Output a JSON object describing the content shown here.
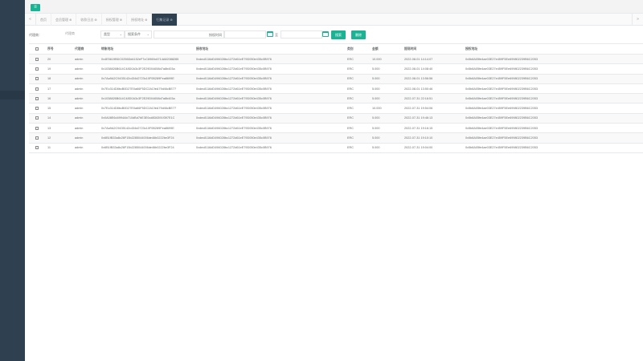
{
  "menu_button": "≡",
  "tab_prev": "«",
  "tab_next": "»",
  "tabs": [
    {
      "label": "首页",
      "closable": false
    },
    {
      "label": "会员管理",
      "closable": true
    },
    {
      "label": "收款日志",
      "closable": true
    },
    {
      "label": "授权管理",
      "closable": true
    },
    {
      "label": "授权地址",
      "closable": true
    },
    {
      "label": "归集记录",
      "closable": true,
      "active": true
    }
  ],
  "filters": {
    "agent_label": "代理商：",
    "agent_placeholder": "代理商",
    "type_select": "类型",
    "field_select": "搜索条件",
    "time_label": "授权时间",
    "to_label": "至",
    "search_button": "搜索",
    "delete_button": "删除"
  },
  "table": {
    "headers": [
      "",
      "序号",
      "代理商",
      "转账地址",
      "接收地址",
      "类别",
      "金额",
      "提现时间",
      "授权地址"
    ],
    "rows": [
      [
        "20",
        "admin",
        "0x4E5619BDC0256Dd4152eF7cC6969c6714A82088285",
        "0xdec8116dD496028bc1272d61eE79D050e435c0B976",
        "ERC",
        "10.000",
        "2022-08-01 14:14:07",
        "0x5b8A05fe4ae03E27e459F5Ee699802239B6C2053"
      ],
      [
        "19",
        "admin",
        "0x1038826B614C48D0A3c3F2E29D04658d7a8b403a",
        "0xdec8116dD496028bc1272d61eE79D050e435c0B976",
        "ERC",
        "5.000",
        "2022-08-01 14:08:40",
        "0x5b8A05fe4ae03E27e459F5Ee699802239B6C2053"
      ],
      [
        "18",
        "admin",
        "0x7Aa9A2C9435142c434d2723c10F0B289Fea8699E",
        "0xdec8116dD496028bc1272d61eE79D050e435c0B976",
        "ERC",
        "5.000",
        "2022-08-01 13:56:56",
        "0x5b8A05fe4ae03E27e459F5Ee699802239B6C2053"
      ],
      [
        "17",
        "admin",
        "0x7Ec314D8bcB0D27E0a66F5DC2ACfeA79d46cBE77",
        "0xdec8116dD496028bc1272d61eE79D050e435c0B976",
        "ERC",
        "5.000",
        "2022-08-01 13:50:46",
        "0x5b8A05fe4ae03E27e459F5Ee699802239B6C2053"
      ],
      [
        "16",
        "admin",
        "0x1038826B614C48D0A3c3F2E29D04658d7a8b403a",
        "0xdec8116dD496028bc1272d61eE79D050e435c0B976",
        "ERC",
        "5.000",
        "2022-07-31 22:16:51",
        "0x5b8A05fe4ae03E27e459F5Ee699802239B6C2053"
      ],
      [
        "15",
        "admin",
        "0x7Ec314D8bcB0D27E0a66F5DC2ACfeA79d46cBE77",
        "0xdec8116dD496028bc1272d61eE79D050e435c0B976",
        "ERC",
        "10.000",
        "2022-07-31 19:54:06",
        "0x5b8A05fe4ae03E27e459F5Ee699802239B6C2053"
      ],
      [
        "14",
        "admin",
        "0x0A08E6d4994Ab710dBd7bE3E0cd8D6391f397E1C",
        "0xdec8116dD496028bc1272d61eE79D050e435c0B976",
        "ERC",
        "5.000",
        "2022-07-31 19:46:13",
        "0x5b8A05fe4ae03E27e459F5Ee699802239B6C2053"
      ],
      [
        "13",
        "admin",
        "0x7Aa9A2C9435142c434d2723c10F0B289Fea8699E",
        "0xdec8116dD496028bc1272d61eE79D050e435c0B976",
        "ERC",
        "5.000",
        "2022-07-31 19:16:15",
        "0x5b8A05fe4ae03E27e459F5Ee699802239B6C2053"
      ],
      [
        "12",
        "admin",
        "0x6B1fB33a8c26F15b2285044006de46b0222be3F24",
        "0xdec8116dD496028bc1272d61eE79D050e435c0B976",
        "ERC",
        "5.000",
        "2022-07-31 19:10:10",
        "0x5b8A05fe4ae03E27e459F5Ee699802239B6C2053"
      ],
      [
        "11",
        "admin",
        "0x6B1fB33a8c26F15b2285044006de46b0222be3F24",
        "0xdec8116dD496028bc1272d61eE79D050e435c0B976",
        "ERC",
        "5.000",
        "2022-07-31 19:04:00",
        "0x5b8A05fe4ae03E27e459F5Ee699802239B6C2053"
      ]
    ]
  },
  "colors": {
    "accent": "#1ab394",
    "sidebar": "#2f4050",
    "active_tab": "#2f4050"
  }
}
